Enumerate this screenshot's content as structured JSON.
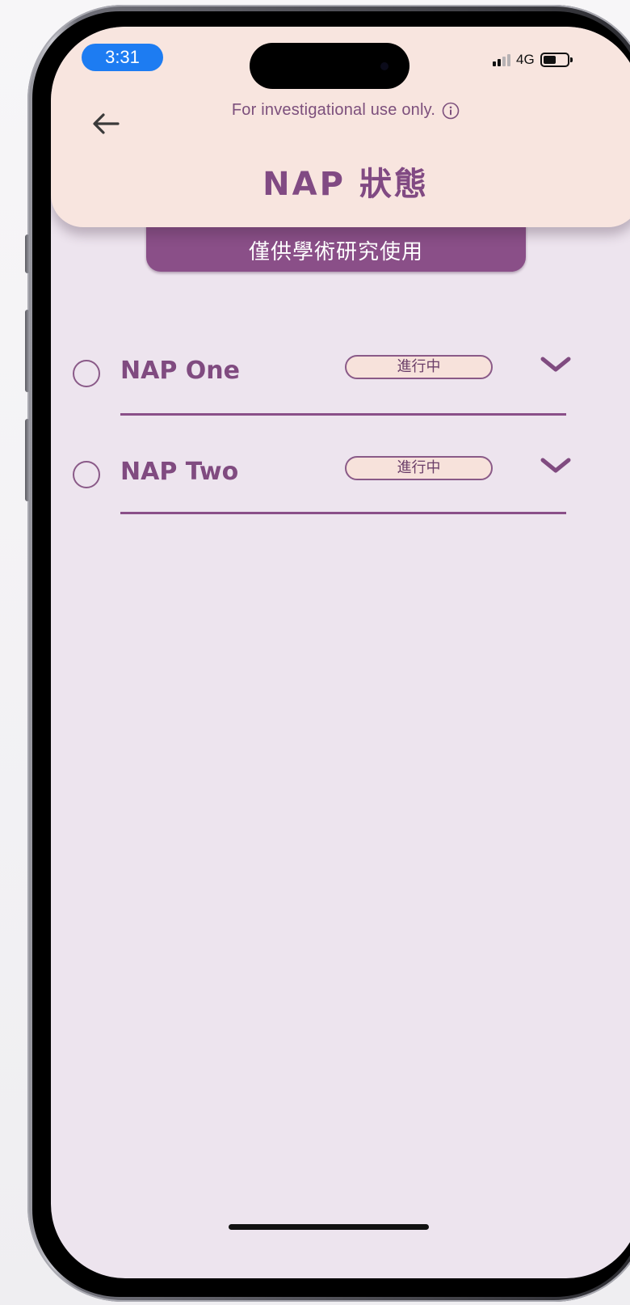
{
  "status_bar": {
    "time": "3:31",
    "network": "4G",
    "battery_level": 0.55
  },
  "header": {
    "disclaimer": "For investigational use only.",
    "title": "NAP 狀態"
  },
  "banner": {
    "text": "僅供學術研究使用"
  },
  "naps": [
    {
      "name": "NAP One",
      "status": "進行中"
    },
    {
      "name": "NAP Two",
      "status": "進行中"
    }
  ],
  "colors": {
    "header_bg": "#f8e5df",
    "screen_bg": "#ede4ee",
    "accent": "#8a4f88",
    "time_pill": "#1d7cf2"
  },
  "icons": [
    "back-arrow-icon",
    "info-icon",
    "chevron-down-icon",
    "signal-icon",
    "battery-icon"
  ]
}
